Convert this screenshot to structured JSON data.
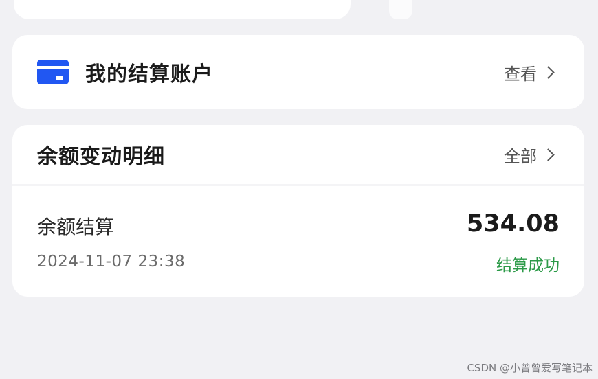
{
  "account": {
    "title": "我的结算账户",
    "action_label": "查看",
    "icon": "card-icon"
  },
  "balance_changes": {
    "title": "余额变动明细",
    "action_label": "全部",
    "entries": [
      {
        "name": "余额结算",
        "time": "2024-11-07 23:38",
        "amount": "534.08",
        "status": "结算成功"
      }
    ]
  },
  "watermark": "CSDN @小曾曾爱写笔记本",
  "colors": {
    "background": "#f1f1f4",
    "card": "#ffffff",
    "accent_blue": "#2157f2",
    "success_green": "#2c9a48"
  }
}
